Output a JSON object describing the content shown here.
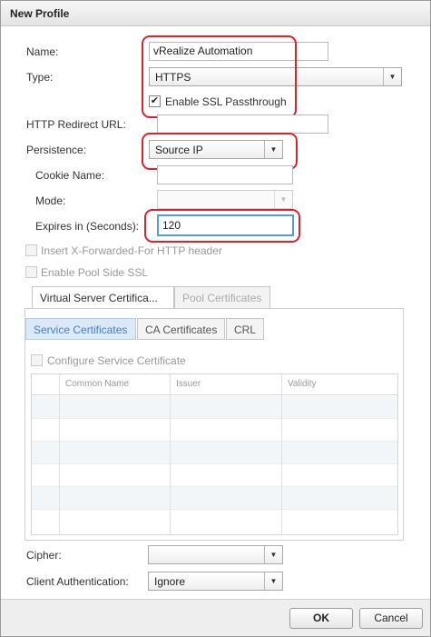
{
  "dialog": {
    "title": "New Profile"
  },
  "form": {
    "name_label": "Name:",
    "name_value": "vRealize Automation",
    "type_label": "Type:",
    "type_value": "HTTPS",
    "ssl_passthrough_label": "Enable SSL Passthrough",
    "ssl_passthrough_checked": true,
    "redirect_label": "HTTP Redirect URL:",
    "redirect_value": "",
    "persistence_label": "Persistence:",
    "persistence_value": "Source IP",
    "cookie_label": "Cookie Name:",
    "cookie_value": "",
    "mode_label": "Mode:",
    "mode_value": "",
    "expires_label": "Expires in (Seconds):",
    "expires_value": "120",
    "xff_label": "Insert X-Forwarded-For HTTP header",
    "pool_ssl_label": "Enable Pool Side SSL"
  },
  "tabs": [
    {
      "label": "Virtual Server Certifica..."
    },
    {
      "label": "Pool Certificates"
    }
  ],
  "subtabs": [
    {
      "label": "Service Certificates"
    },
    {
      "label": "CA Certificates"
    },
    {
      "label": "CRL"
    }
  ],
  "configure_cert_label": "Configure Service Certificate",
  "table": {
    "columns": [
      "Common Name",
      "Issuer",
      "Validity"
    ]
  },
  "cipher": {
    "label": "Cipher:",
    "value": ""
  },
  "client_auth": {
    "label": "Client Authentication:",
    "value": "Ignore"
  },
  "footer": {
    "ok_label": "OK",
    "cancel_label": "Cancel"
  },
  "colors": {
    "highlight": "#d9232f",
    "accent": "#4a7ec4"
  },
  "icons": {
    "dropdown": "chevron-down-icon",
    "check": "checkmark-icon"
  }
}
